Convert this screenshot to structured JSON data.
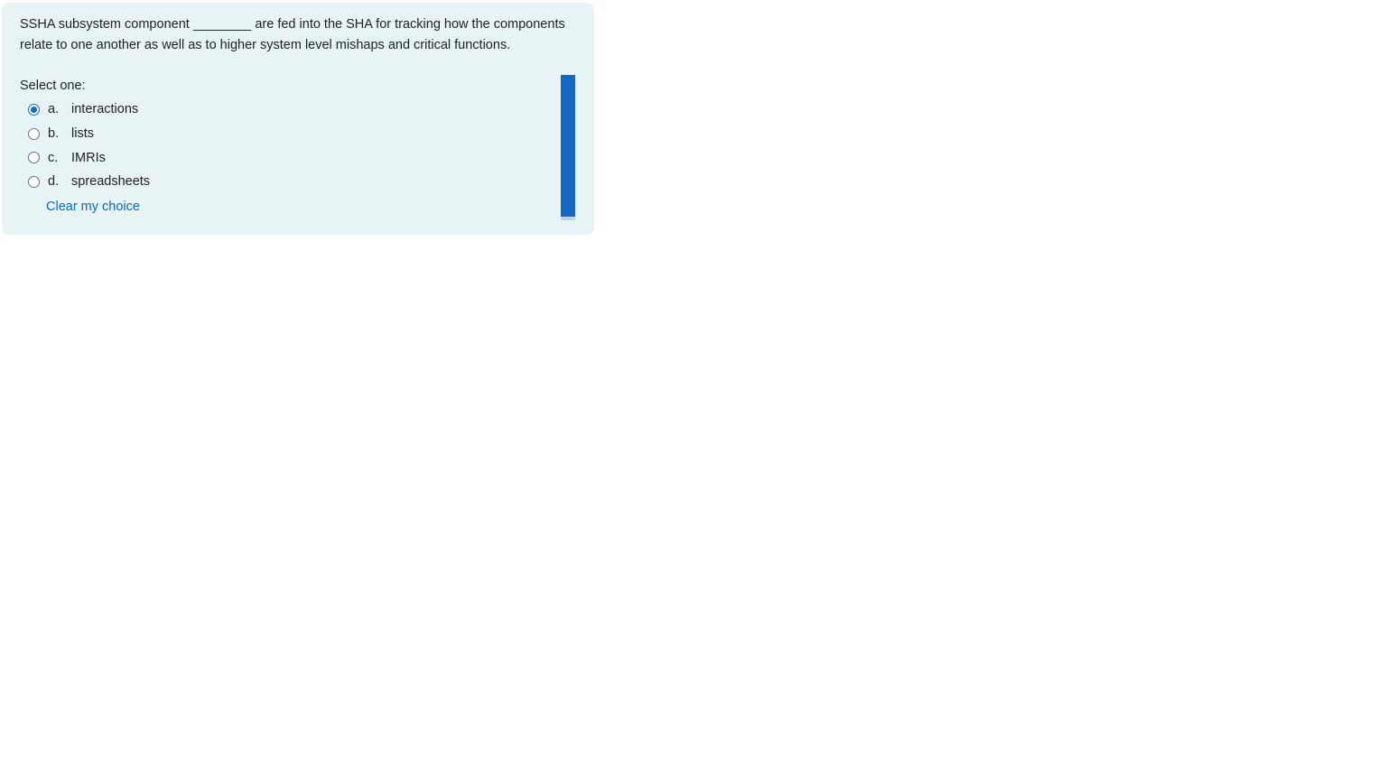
{
  "question": {
    "text": "SSHA subsystem component ________ are fed into the SHA for tracking how the components relate to one another as well as to higher system level mishaps and critical functions.",
    "prompt": "Select one:",
    "answers": [
      {
        "letter": "a.",
        "label": "interactions",
        "selected": true
      },
      {
        "letter": "b.",
        "label": "lists",
        "selected": false
      },
      {
        "letter": "c.",
        "label": "IMRIs",
        "selected": false
      },
      {
        "letter": "d.",
        "label": "spreadsheets",
        "selected": false
      }
    ],
    "clear_label": "Clear my choice"
  },
  "colors": {
    "card_background": "#e7f3f5",
    "accent": "#0f6cbf",
    "scrollbar_thumb": "#1467c2"
  }
}
